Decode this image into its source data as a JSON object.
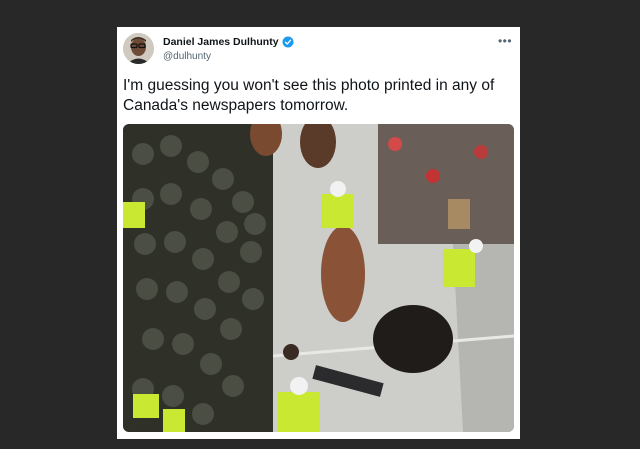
{
  "tweet": {
    "author_name": "Daniel James Dulhunty",
    "author_handle": "@dulhunty",
    "verified": true,
    "more_label": "•••",
    "text": "I'm guessing you won't see this photo printed in any of Canada's newspapers tomorrow.",
    "photo_description_icon": "photo"
  },
  "colors": {
    "background": "#282828",
    "card": "#ffffff",
    "verified_badge": "#1d9bf0",
    "hi_vis": "#c9e832"
  }
}
